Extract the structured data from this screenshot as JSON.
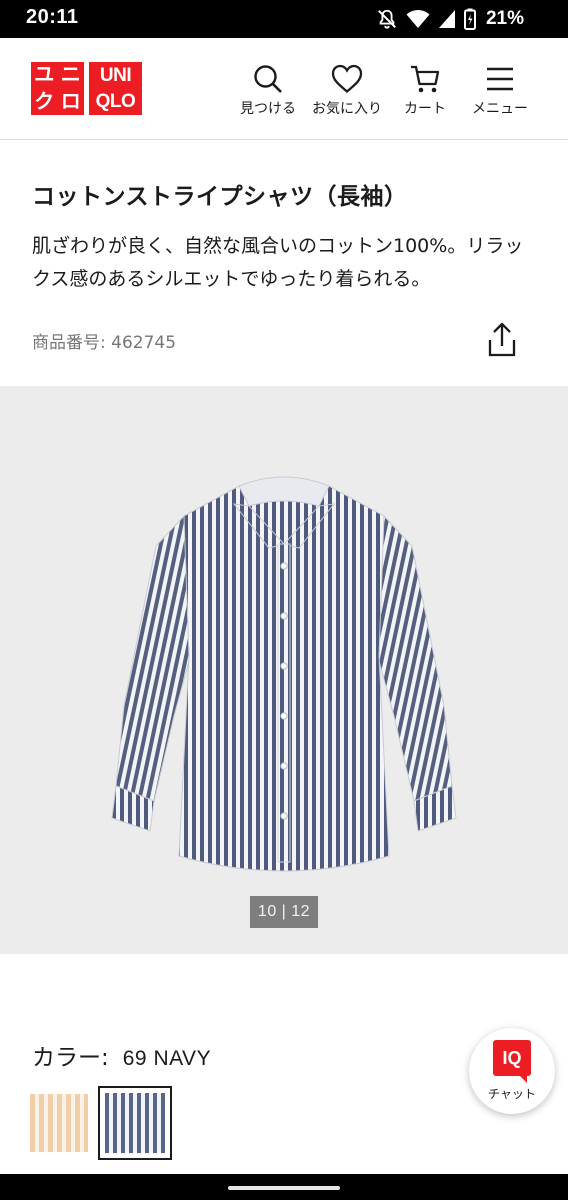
{
  "status_bar": {
    "time": "20:11",
    "battery": "21%",
    "icons": [
      "mute-bell-icon",
      "wifi-icon",
      "signal-icon",
      "battery-icon"
    ]
  },
  "header": {
    "logo_kana": [
      "ユ",
      "ニ",
      "ク",
      "ロ"
    ],
    "logo_latin": [
      "UNI",
      "QLO"
    ],
    "brand_color": "#ed1d24",
    "nav": [
      {
        "label": "見つける",
        "icon": "search-icon"
      },
      {
        "label": "お気に入り",
        "icon": "heart-icon"
      },
      {
        "label": "カート",
        "icon": "cart-icon"
      },
      {
        "label": "メニュー",
        "icon": "menu-icon"
      }
    ]
  },
  "product": {
    "title": "コットンストライプシャツ（長袖）",
    "description": "肌ざわりが良く、自然な風合いのコットン100%。リラックス感のあるシルエットでゆったり着られる。",
    "code_label": "商品番号:",
    "code_value": "462745"
  },
  "gallery": {
    "counter": "10 | 12"
  },
  "color": {
    "label": "カラー:",
    "selected": "69 NAVY",
    "swatches": [
      {
        "icon": "beige-stripe-swatch",
        "colors": [
          "#f0cfa9",
          "#fbf3ea"
        ]
      },
      {
        "icon": "navy-stripe-swatch",
        "colors": [
          "#5a6688",
          "#f4f5f8"
        ],
        "selected": true
      }
    ]
  },
  "chat": {
    "badge": "IQ",
    "label": "チャット"
  }
}
